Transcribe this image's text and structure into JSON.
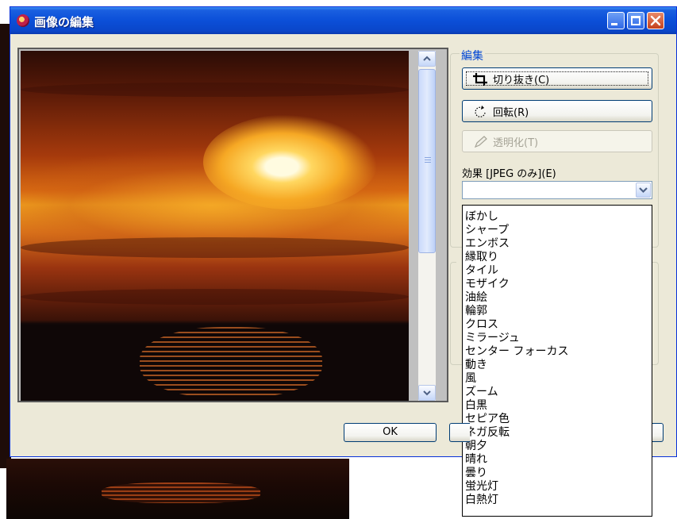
{
  "window": {
    "title": "画像の編集"
  },
  "edit_group": {
    "legend": "編集",
    "crop_label": "切り抜き(C)",
    "rotate_label": "回転(R)",
    "transparent_label": "透明化(T)",
    "effect_label": "効果 [JPEG のみ](E)",
    "effect_value": ""
  },
  "effects_list": [
    "ぼかし",
    "シャープ",
    "エンボス",
    "縁取り",
    "タイル",
    "モザイク",
    "油絵",
    "輪郭",
    "クロス",
    "ミラージュ",
    "センター フォーカス",
    "動き",
    "風",
    "ズーム",
    "白黒",
    "セピア色",
    "ネガ反転",
    "朝夕",
    "晴れ",
    "曇り",
    "蛍光灯",
    "白熱灯"
  ],
  "footer": {
    "ok_label": "OK"
  },
  "colors": {
    "title_bar": "#0b4fd8",
    "dialog_bg": "#ece9d8",
    "group_label": "#0046d5"
  },
  "icons": {
    "app": "app-icon",
    "crop": "crop-icon",
    "rotate": "rotate-icon",
    "transparent": "pen-icon",
    "combo": "chevron-down-icon"
  }
}
